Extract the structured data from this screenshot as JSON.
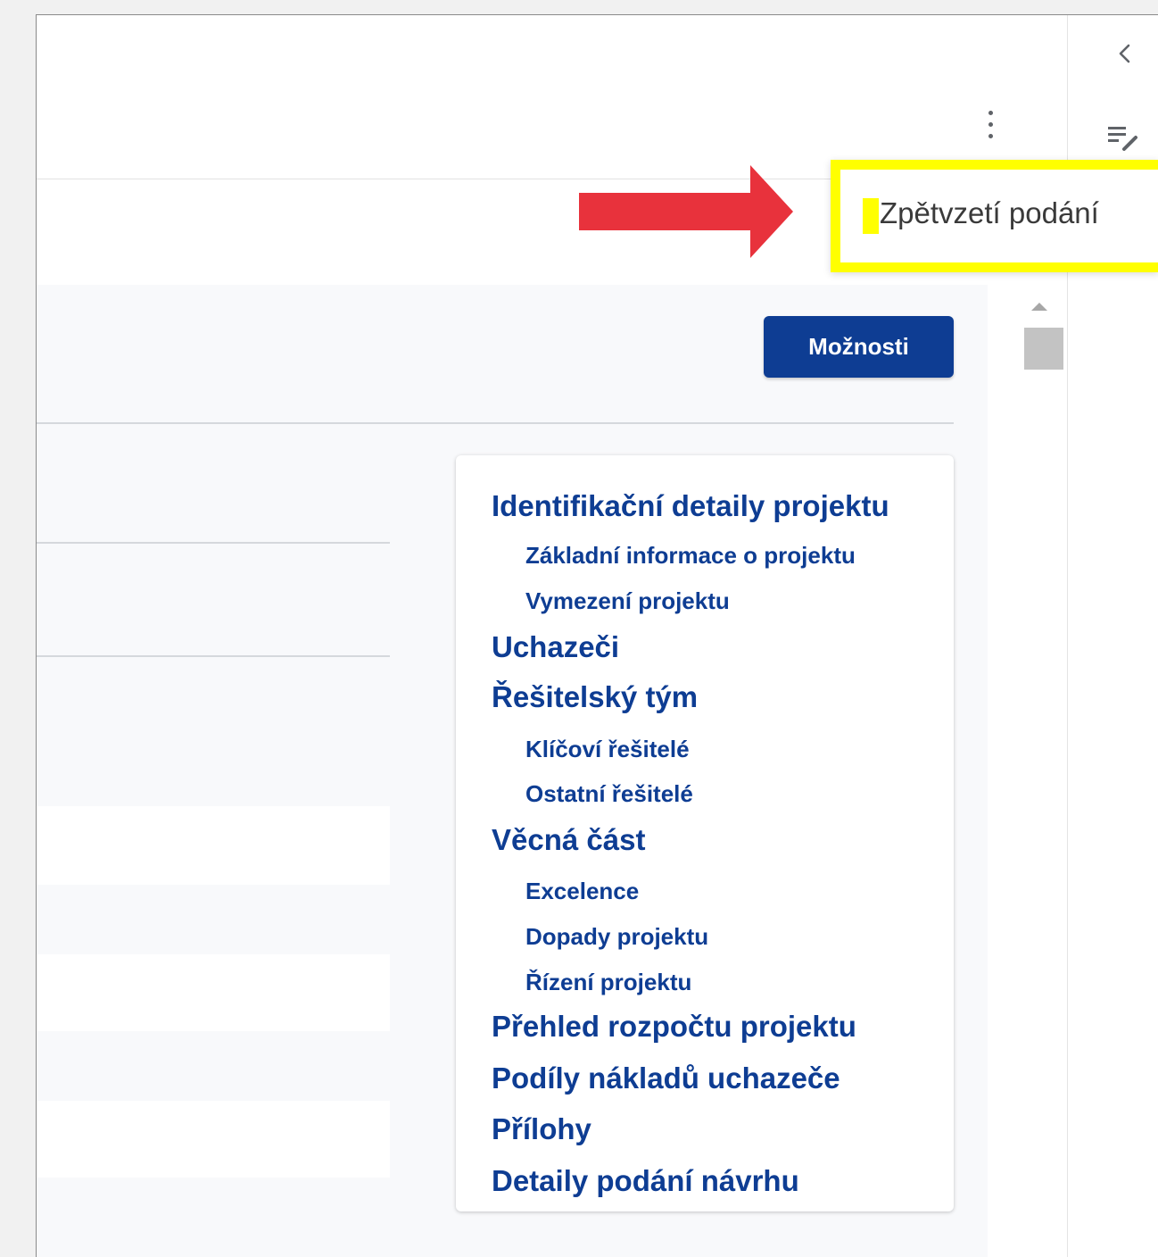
{
  "toolbar": {
    "options_label": "Možnosti"
  },
  "menu": {
    "withdraw_label": "Zpětvzetí podání"
  },
  "icons": {
    "more": "more-vertical-icon",
    "collapse": "chevron-left-icon",
    "notes": "edit-notes-icon",
    "annotation": "red-arrow"
  },
  "colors": {
    "brand": "#0e3d93",
    "highlight": "#ffff00",
    "arrow": "#e8323c"
  },
  "toc": {
    "items": [
      {
        "label": "Identifikační detaily projektu",
        "level": 1
      },
      {
        "label": "Základní informace o projektu",
        "level": 2
      },
      {
        "label": "Vymezení projektu",
        "level": 2
      },
      {
        "label": "Uchazeči",
        "level": 1
      },
      {
        "label": "Řešitelský tým",
        "level": 1
      },
      {
        "label": "Klíčoví řešitelé",
        "level": 2
      },
      {
        "label": "Ostatní řešitelé",
        "level": 2
      },
      {
        "label": "Věcná část",
        "level": 1
      },
      {
        "label": "Excelence",
        "level": 2
      },
      {
        "label": "Dopady projektu",
        "level": 2
      },
      {
        "label": "Řízení projektu",
        "level": 2
      },
      {
        "label": "Přehled rozpočtu projektu",
        "level": 1
      },
      {
        "label": "Podíly nákladů uchazeče",
        "level": 1
      },
      {
        "label": "Přílohy",
        "level": 1
      },
      {
        "label": "Detaily podání návrhu",
        "level": 1
      }
    ]
  }
}
